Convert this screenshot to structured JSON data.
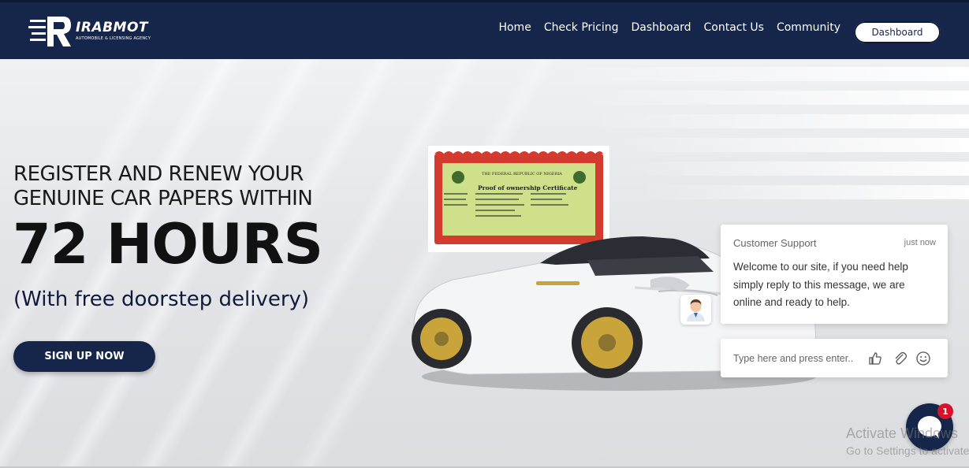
{
  "brand": {
    "name": "IRABMOT",
    "tagline": "AUTOMOBILE & LICENSING AGENCY"
  },
  "nav": {
    "items": [
      "Home",
      "Check Pricing",
      "Dashboard",
      "Contact Us",
      "Community"
    ],
    "button_label": "Dashboard"
  },
  "hero": {
    "headline_line1": "REGISTER AND RENEW YOUR",
    "headline_line2": "GENUINE CAR PAPERS WITHIN",
    "big_text": "72 HOURS",
    "subtext": "(With free doorstep delivery)",
    "cta_label": "SIGN UP NOW",
    "certificate": {
      "heading": "THE FEDERAL REPUBLIC OF NIGERIA",
      "title": "Proof of ownership Certificate"
    }
  },
  "chat": {
    "title": "Customer Support",
    "time": "just now",
    "message": "Welcome to our site, if you need help simply reply to this message, we are online and ready to help.",
    "input_placeholder": "Type here and press enter..",
    "badge_count": "1"
  },
  "watermark": {
    "line1": "Activate Windows",
    "line2": "Go to Settings to activate Windows."
  },
  "colors": {
    "navy": "#15264a",
    "accent_red": "#d9122a",
    "cert_green": "#cfe08a",
    "cert_border": "#d33b2f"
  }
}
